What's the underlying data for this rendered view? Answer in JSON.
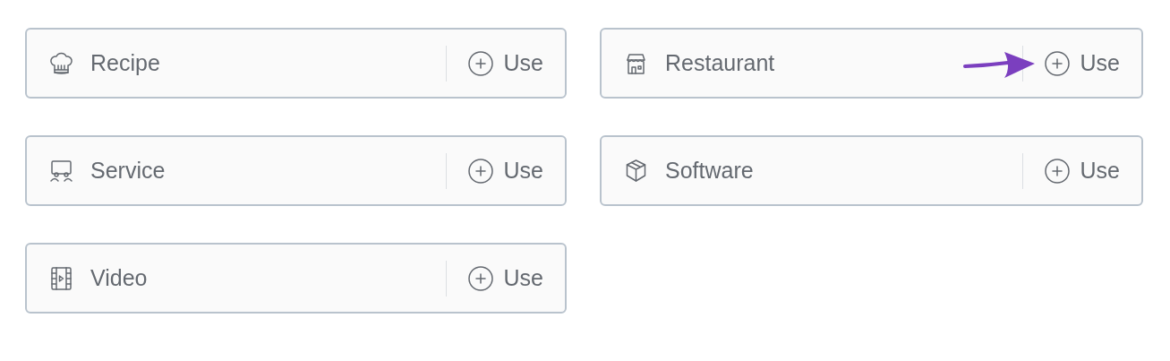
{
  "schemas": [
    {
      "label": "Recipe",
      "kind": "hat",
      "action": "Use",
      "pointed": false
    },
    {
      "label": "Restaurant",
      "kind": "store",
      "action": "Use",
      "pointed": true
    },
    {
      "label": "Service",
      "kind": "cart",
      "action": "Use",
      "pointed": false
    },
    {
      "label": "Software",
      "kind": "box",
      "action": "Use",
      "pointed": false
    },
    {
      "label": "Video",
      "kind": "film",
      "action": "Use",
      "pointed": false
    }
  ]
}
